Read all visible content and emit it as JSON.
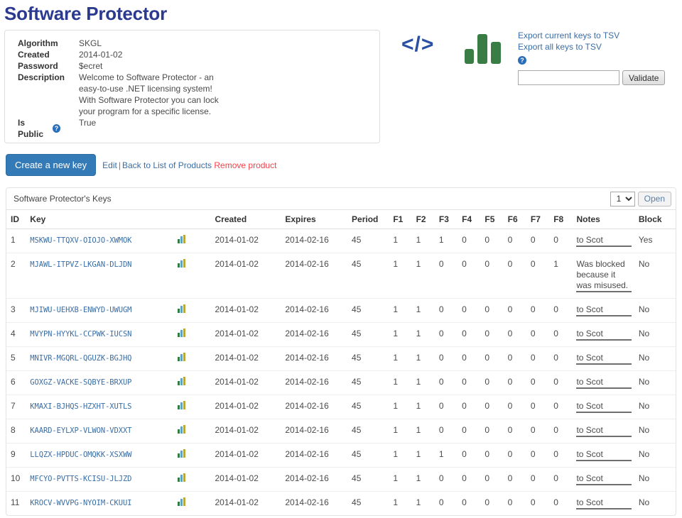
{
  "page_title": "Software Protector",
  "product_info": {
    "fields": [
      {
        "label": "Algorithm",
        "value": "SKGL",
        "has_help": false
      },
      {
        "label": "Created",
        "value": "2014-01-02",
        "has_help": false
      },
      {
        "label": "Password",
        "value": "$ecret",
        "has_help": false
      },
      {
        "label": "Description",
        "value": "Welcome to Software Protector - an easy-to-use .NET licensing system! With Software Protector you can lock your program for a specific license.",
        "has_help": false
      },
      {
        "label": "Is Public",
        "value": "True",
        "has_help": true
      }
    ],
    "description_lines": [
      "Welcome to Software Protector - an",
      "easy-to-use .NET licensing system!",
      "With Software Protector you can lock",
      "your program for a specific license."
    ],
    "help_glyph": "?"
  },
  "top_right": {
    "code_icon_label": "</>",
    "code_icon_name": "code-icon",
    "chart_icon_name": "bar-chart-icon",
    "export_current_label": "Export current keys to TSV",
    "export_all_label": "Export all keys to TSV",
    "help_glyph": "?",
    "validate_input_value": "",
    "validate_input_placeholder": "",
    "validate_button_label": "Validate"
  },
  "actions": {
    "create_key_label": "Create a new key",
    "edit_label": "Edit",
    "separator": "|",
    "back_label": "Back to List of Products",
    "remove_label": "Remove product"
  },
  "keys_panel": {
    "title": "Software Protector's Keys",
    "page_value": "1",
    "page_options": [
      "1"
    ],
    "open_label": "Open",
    "columns": [
      "ID",
      "Key",
      "",
      "Created",
      "Expires",
      "Period",
      "F1",
      "F2",
      "F3",
      "F4",
      "F5",
      "F6",
      "F7",
      "F8",
      "Notes",
      "Block"
    ],
    "rows": [
      {
        "id": "1",
        "key": "MSKWU-TTQXV-OIOJO-XWMOK",
        "created": "2014-01-02",
        "expires": "2014-02-16",
        "period": "45",
        "f": [
          "1",
          "1",
          "1",
          "0",
          "0",
          "0",
          "0",
          "0"
        ],
        "notes": "to Scot",
        "block": "Yes"
      },
      {
        "id": "2",
        "key": "MJAWL-ITPVZ-LKGAN-DLJDN",
        "created": "2014-01-02",
        "expires": "2014-02-16",
        "period": "45",
        "f": [
          "1",
          "1",
          "0",
          "0",
          "0",
          "0",
          "0",
          "1"
        ],
        "notes": "Was blocked because it was misused.",
        "block": "No"
      },
      {
        "id": "3",
        "key": "MJIWU-UEHXB-ENWYD-UWUGM",
        "created": "2014-01-02",
        "expires": "2014-02-16",
        "period": "45",
        "f": [
          "1",
          "1",
          "0",
          "0",
          "0",
          "0",
          "0",
          "0"
        ],
        "notes": "to Scot",
        "block": "No"
      },
      {
        "id": "4",
        "key": "MVYPN-HYYKL-CCPWK-IUCSN",
        "created": "2014-01-02",
        "expires": "2014-02-16",
        "period": "45",
        "f": [
          "1",
          "1",
          "0",
          "0",
          "0",
          "0",
          "0",
          "0"
        ],
        "notes": "to Scot",
        "block": "No"
      },
      {
        "id": "5",
        "key": "MNIVR-MGQRL-QGUZK-BGJHQ",
        "created": "2014-01-02",
        "expires": "2014-02-16",
        "period": "45",
        "f": [
          "1",
          "1",
          "0",
          "0",
          "0",
          "0",
          "0",
          "0"
        ],
        "notes": "to Scot",
        "block": "No"
      },
      {
        "id": "6",
        "key": "GOXGZ-VACKE-SQBYE-BRXUP",
        "created": "2014-01-02",
        "expires": "2014-02-16",
        "period": "45",
        "f": [
          "1",
          "1",
          "0",
          "0",
          "0",
          "0",
          "0",
          "0"
        ],
        "notes": "to Scot",
        "block": "No"
      },
      {
        "id": "7",
        "key": "KMAXI-BJHQS-HZXHT-XUTLS",
        "created": "2014-01-02",
        "expires": "2014-02-16",
        "period": "45",
        "f": [
          "1",
          "1",
          "0",
          "0",
          "0",
          "0",
          "0",
          "0"
        ],
        "notes": "to Scot",
        "block": "No"
      },
      {
        "id": "8",
        "key": "KAARD-EYLXP-VLWON-VDXXT",
        "created": "2014-01-02",
        "expires": "2014-02-16",
        "period": "45",
        "f": [
          "1",
          "1",
          "0",
          "0",
          "0",
          "0",
          "0",
          "0"
        ],
        "notes": "to Scot",
        "block": "No"
      },
      {
        "id": "9",
        "key": "LLQZX-HPDUC-OMQKK-XSXWW",
        "created": "2014-01-02",
        "expires": "2014-02-16",
        "period": "45",
        "f": [
          "1",
          "1",
          "1",
          "0",
          "0",
          "0",
          "0",
          "0"
        ],
        "notes": "to Scot",
        "block": "No"
      },
      {
        "id": "10",
        "key": "MFCYO-PVTTS-KCISU-JLJZD",
        "created": "2014-01-02",
        "expires": "2014-02-16",
        "period": "45",
        "f": [
          "1",
          "1",
          "0",
          "0",
          "0",
          "0",
          "0",
          "0"
        ],
        "notes": "to Scot",
        "block": "No"
      },
      {
        "id": "11",
        "key": "KROCV-WVVPG-NYOIM-CKUUI",
        "created": "2014-01-02",
        "expires": "2014-02-16",
        "period": "45",
        "f": [
          "1",
          "1",
          "0",
          "0",
          "0",
          "0",
          "0",
          "0"
        ],
        "notes": "to Scot",
        "block": "No"
      }
    ]
  },
  "colors": {
    "title": "#2b3a8f",
    "link": "#3a6ea5",
    "danger": "#f5404a",
    "success": "#3c9b5a",
    "primary_button": "#337ab7",
    "chart_green": "#3a7d44"
  }
}
